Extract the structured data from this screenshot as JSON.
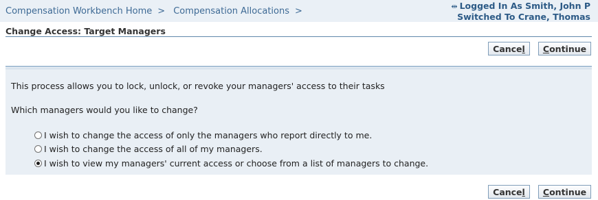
{
  "breadcrumbs": [
    {
      "label": "Compensation Workbench Home",
      "separator": ">"
    },
    {
      "label": "Compensation Allocations",
      "separator": ">"
    }
  ],
  "user": {
    "logged_in": "Logged In As Smith, John P",
    "switched": "Switched To Crane, Thomas"
  },
  "page": {
    "title": "Change Access: Target Managers"
  },
  "buttons": {
    "cancel_pre": "Cance",
    "cancel_underlined": "l",
    "continue_pre": "",
    "continue_underlined": "C",
    "continue_post": "ontinue"
  },
  "content": {
    "intro": "This process allows you to lock, unlock, or revoke your managers' access to their tasks",
    "question": "Which managers would you like to change?",
    "options": [
      {
        "label": "I wish to change the access of only the managers who report directly to me.",
        "selected": false
      },
      {
        "label": "I wish to change the access of all of my managers.",
        "selected": false
      },
      {
        "label": "I wish to view my managers' current access or choose from a list of managers to change.",
        "selected": true
      }
    ]
  },
  "colors": {
    "link": "#3e6a95",
    "header_bg": "#eaf0f6",
    "panel_bg": "#e9eff5"
  }
}
